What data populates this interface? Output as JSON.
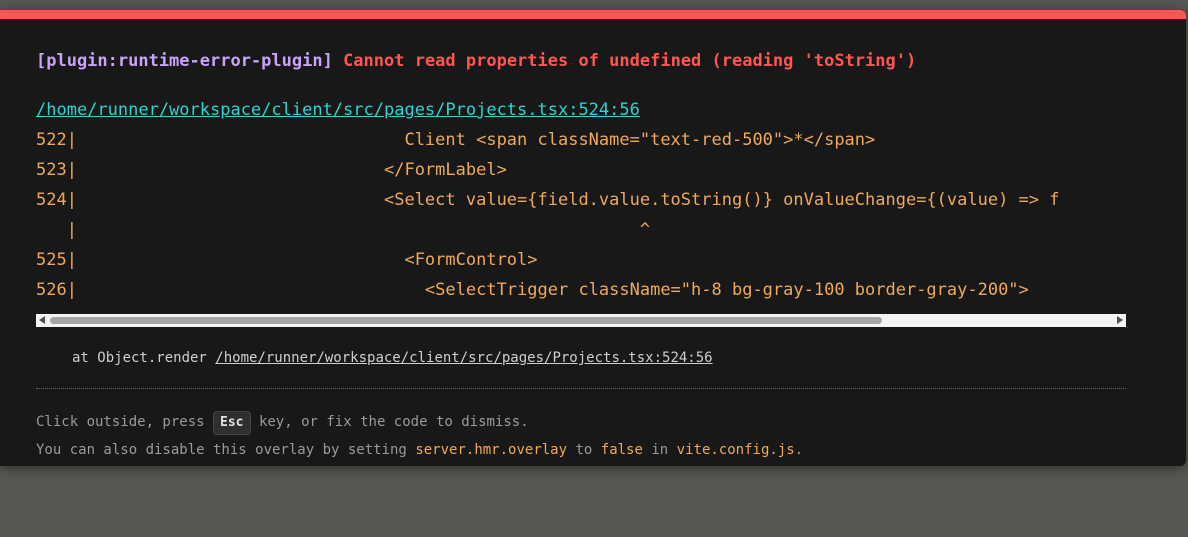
{
  "overlay": {
    "plugin": "[plugin:runtime-error-plugin]",
    "message": "Cannot read properties of undefined (reading 'toString')",
    "file": "/home/runner/workspace/client/src/pages/Projects.tsx:524:56",
    "frame_lines": [
      "522|                                Client <span className=\"text-red-500\">*</span>",
      "523|                              </FormLabel>",
      "524|                              <Select value={field.value.toString()} onValueChange={(value) => f",
      "   |                                                       ^",
      "525|                                <FormControl>",
      "526|                                  <SelectTrigger className=\"h-8 bg-gray-100 border-gray-200\">"
    ],
    "stack_prefix": "at Object.render",
    "stack_link": "/home/runner/workspace/client/src/pages/Projects.tsx:524:56",
    "tip1_before": "Click outside, press",
    "tip1_key": "Esc",
    "tip1_after": "key, or fix the code to dismiss.",
    "tip2_a": "You can also disable this overlay by setting",
    "tip2_code1": "server.hmr.overlay",
    "tip2_b": "to",
    "tip2_code2": "false",
    "tip2_c": "in",
    "tip2_code3": "vite.config.js",
    "tip2_d": "."
  },
  "colors": {
    "accent_bar": "#ff5555",
    "plugin": "#c9a3f7",
    "error": "#ff5555",
    "link": "#2dd4d4",
    "code": "#f0a95a"
  }
}
